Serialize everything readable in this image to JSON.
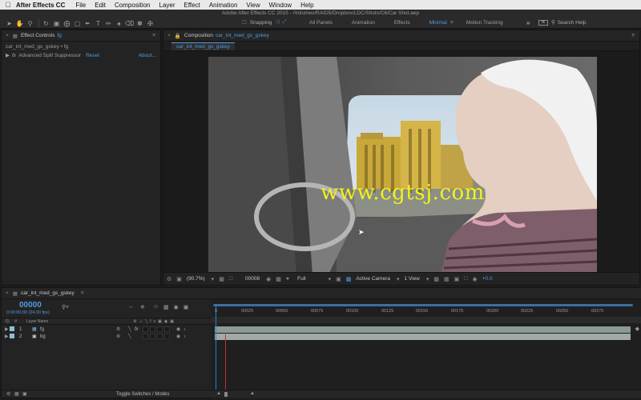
{
  "menubar": {
    "apple": "",
    "app_name": "After Effects CC",
    "items": [
      "File",
      "Edit",
      "Composition",
      "Layer",
      "Effect",
      "Animation",
      "View",
      "Window",
      "Help"
    ]
  },
  "window_title": "Adobe After Effects CC 2015 - /Volumes/RAID5/Dropbox/LDC/Shots/C6/Car Shot.aep",
  "toolbar": {
    "snapping_label": "Snapping",
    "workspaces": [
      {
        "label": "All Panels",
        "active": false
      },
      {
        "label": "Animation",
        "active": false
      },
      {
        "label": "Effects",
        "active": false
      },
      {
        "label": "Minimal",
        "active": true
      },
      {
        "label": "Motion Tracking",
        "active": false
      }
    ],
    "more_glyph": "»",
    "search_help": "Search Help"
  },
  "effect_controls": {
    "tab_label": "Effect Controls",
    "tab_layer": "fg",
    "breadcrumb": "car_int_med_gs_gskey • fg",
    "effect_name": "Advanced Spill Suppressor",
    "reset_label": "Reset",
    "about_label": "About..."
  },
  "composition": {
    "tab_label": "Composition",
    "tab_name": "car_int_med_gs_gskey",
    "subtab": "car_int_med_gs_gskey",
    "watermark": "www.cgtsj.com",
    "footer": {
      "zoom": "(90.7%)",
      "timecode": "00008",
      "resolution": "Full",
      "camera": "Active Camera",
      "views": "1 View",
      "exposure": "+0.0"
    }
  },
  "timeline": {
    "tab_name": "car_int_med_gs_gskey",
    "timecode": "00000",
    "fps": "0:00:00:00 (24.00 fps)",
    "column_hash": "#",
    "column_layer_name": "Layer Name",
    "ruler_ticks": [
      "00025",
      "00050",
      "00075",
      "00100",
      "00125",
      "00150",
      "00175",
      "00200",
      "00225",
      "00250",
      "00275"
    ],
    "ruler_start": "0",
    "layers": [
      {
        "num": "1",
        "name": "fg",
        "has_fx": true
      },
      {
        "num": "2",
        "name": "bg",
        "has_fx": false
      }
    ],
    "toggle_label": "Toggle Switches / Modes"
  },
  "colors": {
    "accent": "#4f9be2",
    "watermark": "#f2f21a",
    "layer_bar": "#8a9b93",
    "label_color": "#8fc0d2"
  }
}
